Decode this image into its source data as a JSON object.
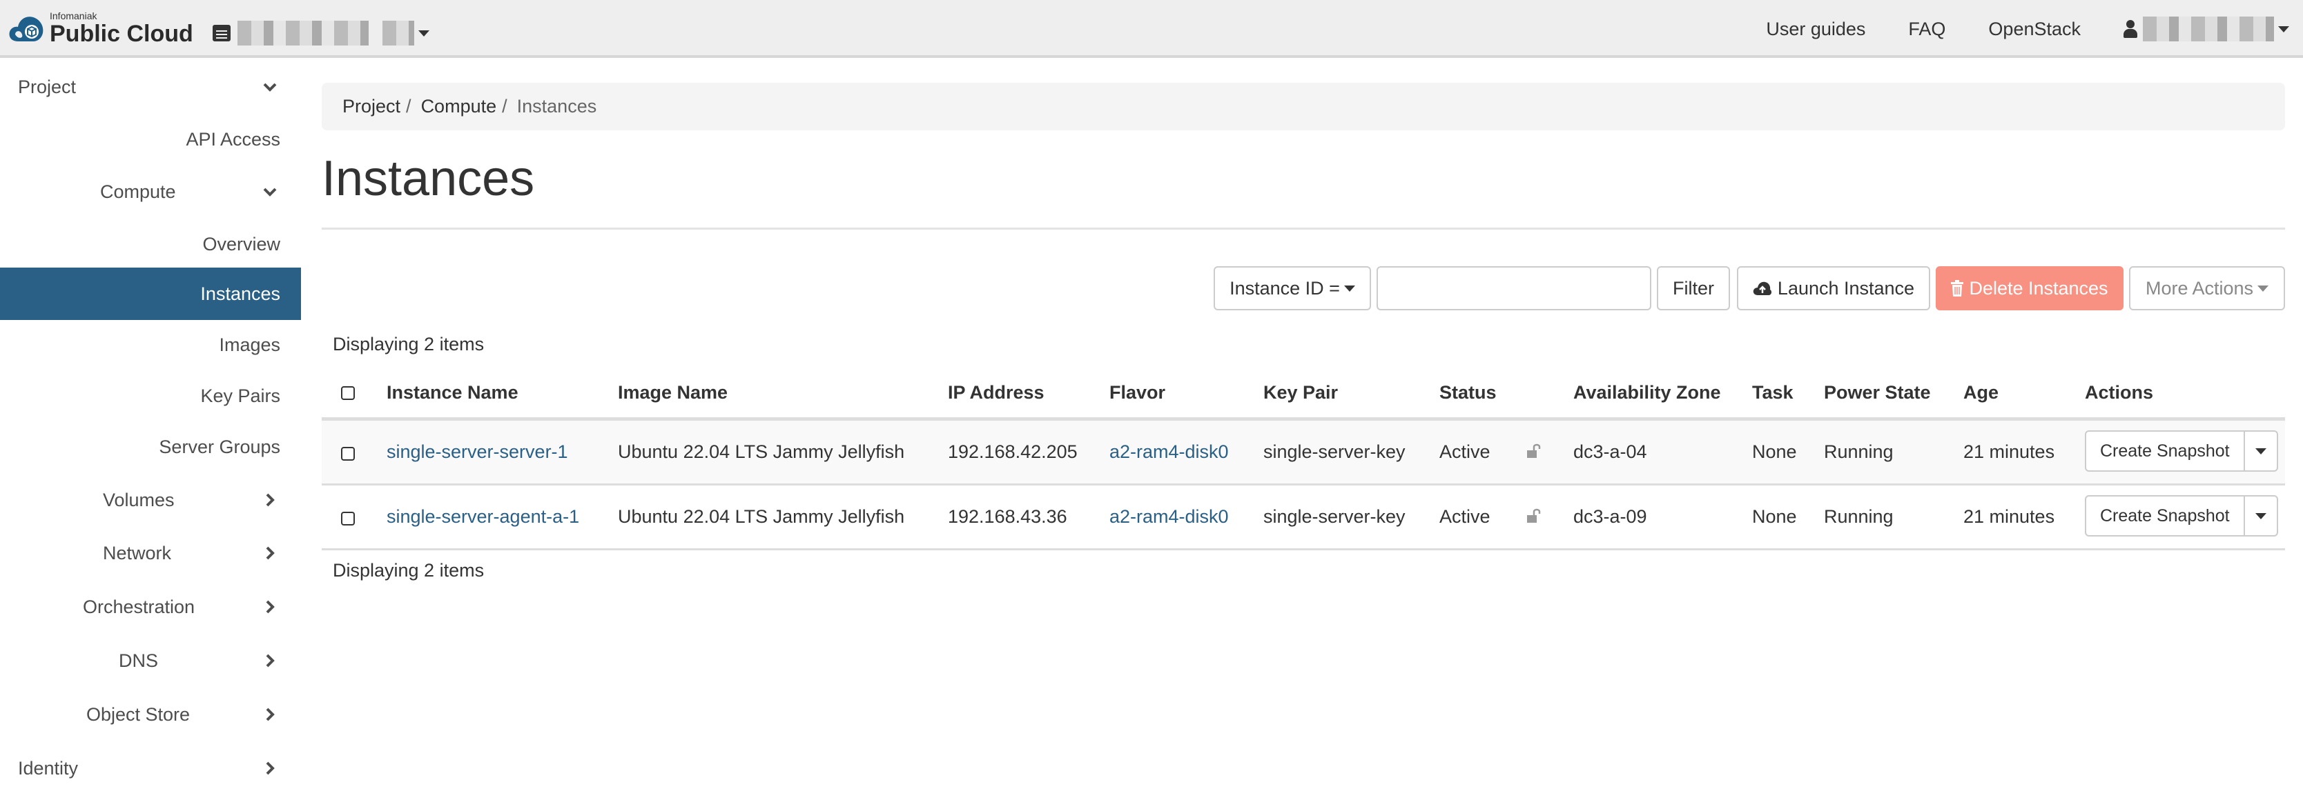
{
  "navbar": {
    "brand_sub": "Infomaniak",
    "brand_main": "Public Cloud",
    "links": [
      {
        "label": "User guides"
      },
      {
        "label": "FAQ"
      },
      {
        "label": "OpenStack"
      }
    ]
  },
  "sidebar": {
    "items": [
      {
        "label": "Project",
        "icon": "chevron-down-icon"
      },
      {
        "label": "API Access"
      },
      {
        "label": "Compute",
        "icon": "chevron-down-icon"
      },
      {
        "label": "Overview"
      },
      {
        "label": "Instances",
        "active": true
      },
      {
        "label": "Images"
      },
      {
        "label": "Key Pairs"
      },
      {
        "label": "Server Groups"
      },
      {
        "label": "Volumes",
        "icon": "chevron-right-icon"
      },
      {
        "label": "Network",
        "icon": "chevron-right-icon"
      },
      {
        "label": "Orchestration",
        "icon": "chevron-right-icon"
      },
      {
        "label": "DNS",
        "icon": "chevron-right-icon"
      },
      {
        "label": "Object Store",
        "icon": "chevron-right-icon"
      },
      {
        "label": "Identity",
        "icon": "chevron-right-icon"
      }
    ],
    "active_color": "#2a5f86"
  },
  "breadcrumb": [
    "Project",
    "Compute",
    "Instances"
  ],
  "page_title": "Instances",
  "toolbar": {
    "filter_field": "Instance ID =",
    "filter_value": "",
    "filter_button": "Filter",
    "launch_button": "Launch Instance",
    "delete_button": "Delete Instances",
    "more_actions": "More Actions"
  },
  "table": {
    "count_top": "Displaying 2 items",
    "count_bottom": "Displaying 2 items",
    "columns": [
      "Instance Name",
      "Image Name",
      "IP Address",
      "Flavor",
      "Key Pair",
      "Status",
      "Availability Zone",
      "Task",
      "Power State",
      "Age",
      "Actions"
    ],
    "rows": [
      {
        "name": "single-server-server-1",
        "image": "Ubuntu 22.04 LTS Jammy Jellyfish",
        "ip": "192.168.42.205",
        "flavor": "a2-ram4-disk0",
        "keypair": "single-server-key",
        "status": "Active",
        "lock": "unlocked",
        "az": "dc3-a-04",
        "task": "None",
        "power": "Running",
        "age": "21 minutes",
        "action": "Create Snapshot"
      },
      {
        "name": "single-server-agent-a-1",
        "image": "Ubuntu 22.04 LTS Jammy Jellyfish",
        "ip": "192.168.43.36",
        "flavor": "a2-ram4-disk0",
        "keypair": "single-server-key",
        "status": "Active",
        "lock": "unlocked",
        "az": "dc3-a-09",
        "task": "None",
        "power": "Running",
        "age": "21 minutes",
        "action": "Create Snapshot"
      }
    ]
  }
}
